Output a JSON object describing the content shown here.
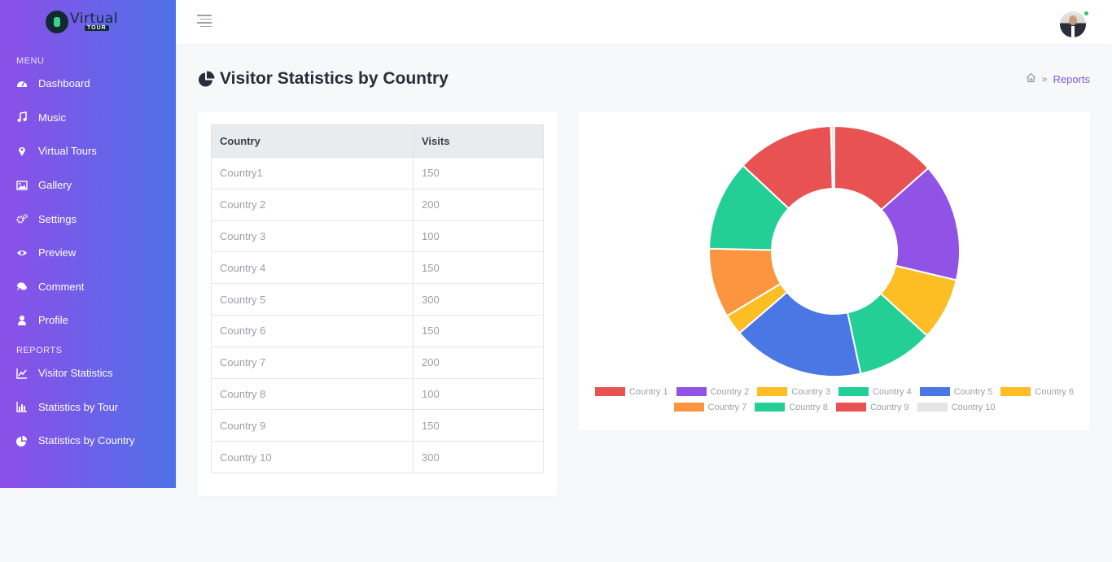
{
  "app": {
    "logo_word": "Virtual",
    "logo_sub": "TOUR"
  },
  "sidebar": {
    "menu_heading": "MENU",
    "menu_items": [
      {
        "label": "Dashboard",
        "icon": "dashboard-icon"
      },
      {
        "label": "Music",
        "icon": "music-icon"
      },
      {
        "label": "Virtual Tours",
        "icon": "map-marker-icon"
      },
      {
        "label": "Gallery",
        "icon": "image-icon"
      },
      {
        "label": "Settings",
        "icon": "cogs-icon"
      },
      {
        "label": "Preview",
        "icon": "eye-icon"
      },
      {
        "label": "Comment",
        "icon": "comments-icon"
      },
      {
        "label": "Profile",
        "icon": "user-icon"
      }
    ],
    "reports_heading": "REPORTS",
    "report_items": [
      {
        "label": "Visitor Statistics",
        "icon": "line-chart-icon"
      },
      {
        "label": "Statistics by Tour",
        "icon": "bar-chart-icon"
      },
      {
        "label": "Statistics by Country",
        "icon": "pie-chart-icon"
      }
    ]
  },
  "header": {
    "title": "Visitor Statistics by Country",
    "breadcrumb": {
      "current": "Reports"
    }
  },
  "table": {
    "headers": [
      "Country",
      "Visits"
    ],
    "rows": [
      [
        "Country1",
        "150"
      ],
      [
        "Country 2",
        "200"
      ],
      [
        "Country 3",
        "100"
      ],
      [
        "Country 4",
        "150"
      ],
      [
        "Country 5",
        "300"
      ],
      [
        "Country 6",
        "150"
      ],
      [
        "Country 7",
        "200"
      ],
      [
        "Country 8",
        "100"
      ],
      [
        "Country 9",
        "150"
      ],
      [
        "Country 10",
        "300"
      ]
    ]
  },
  "colors": {
    "sidebar_gradient_start": "#8e4ee8",
    "sidebar_gradient_end": "#4d72e8",
    "accent": "#7b5be0",
    "online": "#2fc85e"
  },
  "chart_data": {
    "type": "pie",
    "donut": true,
    "categories": [
      "Country 1",
      "Country 2",
      "Country 3",
      "Country 4",
      "Country 5",
      "Country 6",
      "Country 7",
      "Country 8",
      "Country 9",
      "Country 10"
    ],
    "values": [
      150,
      170,
      90,
      110,
      190,
      30,
      100,
      130,
      140,
      5
    ],
    "colors": [
      "#e85252",
      "#9153e6",
      "#fdbd24",
      "#24cf96",
      "#4a77e3",
      "#fdbd24",
      "#fb9540",
      "#24cf96",
      "#e85252",
      "#e5e5e5"
    ],
    "legend_position": "bottom",
    "title": ""
  }
}
